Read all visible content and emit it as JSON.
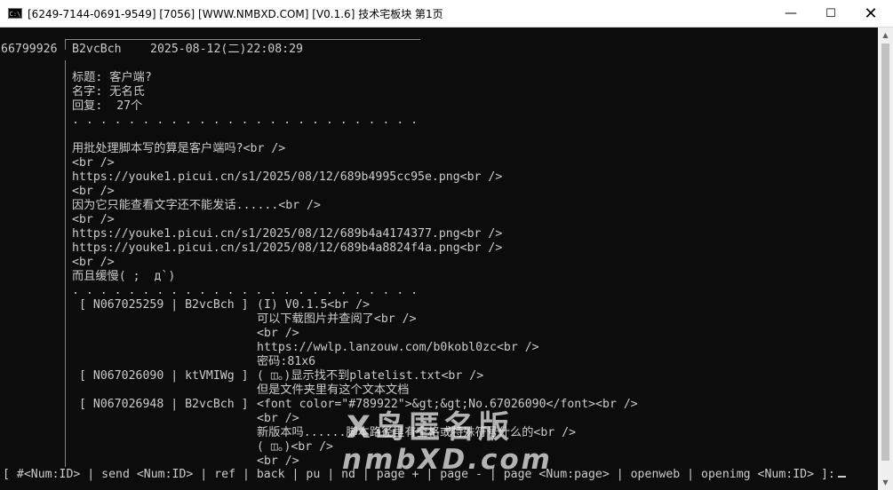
{
  "window": {
    "title": "[6249-7144-0691-9549] [7056] [WWW.NMBXD.COM] [V0.1.6] 技术宅板块   第1页",
    "icon_label": "C:\\",
    "icons": {
      "app": "console-icon",
      "minimize": "minimize-icon",
      "maximize": "maximize-icon",
      "close": "close-icon"
    },
    "minimize_glyph": "—",
    "maximize_glyph": "☐",
    "close_glyph": "✕"
  },
  "post": {
    "id": "66799926",
    "user": "B2vcBch",
    "datetime": "2025-08-12(二)22:08:29",
    "title_line": "标题: 客户端?",
    "name_line": "名字: 无名氏",
    "reply_line": "回复:  27个",
    "dots": ". . . . . . . . . . . . . . . . . . . . . . . . .",
    "content": [
      "用批处理脚本写的算是客户端吗?<br />",
      "<br />",
      "https://youke1.picui.cn/s1/2025/08/12/689b4995cc95e.png<br />",
      "<br />",
      "因为它只能查看文字还不能发话......<br />",
      "<br />",
      "https://youke1.picui.cn/s1/2025/08/12/689b4a4174377.png<br />",
      "https://youke1.picui.cn/s1/2025/08/12/689b4a8824f4a.png<br />",
      "<br />",
      "而且缓慢( ;  д`)"
    ],
    "dots2": ". . . . . . . . . . . . . . . . . . . . . . . . ."
  },
  "replies": [
    {
      "header": "[ N067025259 | B2vcBch ]",
      "lines": [
        "(I) V0.1.5<br />",
        "可以下载图片并查阅了<br />",
        "<br />",
        "https://wwlp.lanzouw.com/b0kobl0zc<br />",
        "密码:81x6"
      ]
    },
    {
      "header": "[ N067026090 | ktVMIWg ]",
      "lines": [
        "( ◫。)显示找不到platelist.txt<br />",
        "但是文件夹里有这个文本文档"
      ]
    },
    {
      "header": "[ N067026948 | B2vcBch ]",
      "lines": [
        "<font color=\"#789922\">&gt;&gt;No.67026090</font><br />",
        "<br />",
        "新版本吗......脚本路径里有空格或特殊符号什么的<br />",
        "( ◫。)<br />",
        "<br />"
      ]
    }
  ],
  "statusbar": {
    "text": "[ #<Num:ID> | send <Num:ID> | ref | back | pu | nd | page + | page - | page <Num:page> | openweb | openimg <Num:ID> ]:"
  },
  "scrollbar": {
    "up_glyph": "▲",
    "down_glyph": "▼"
  },
  "watermark": {
    "line1": "X岛匿名版",
    "line2": "nmbXD.com"
  }
}
